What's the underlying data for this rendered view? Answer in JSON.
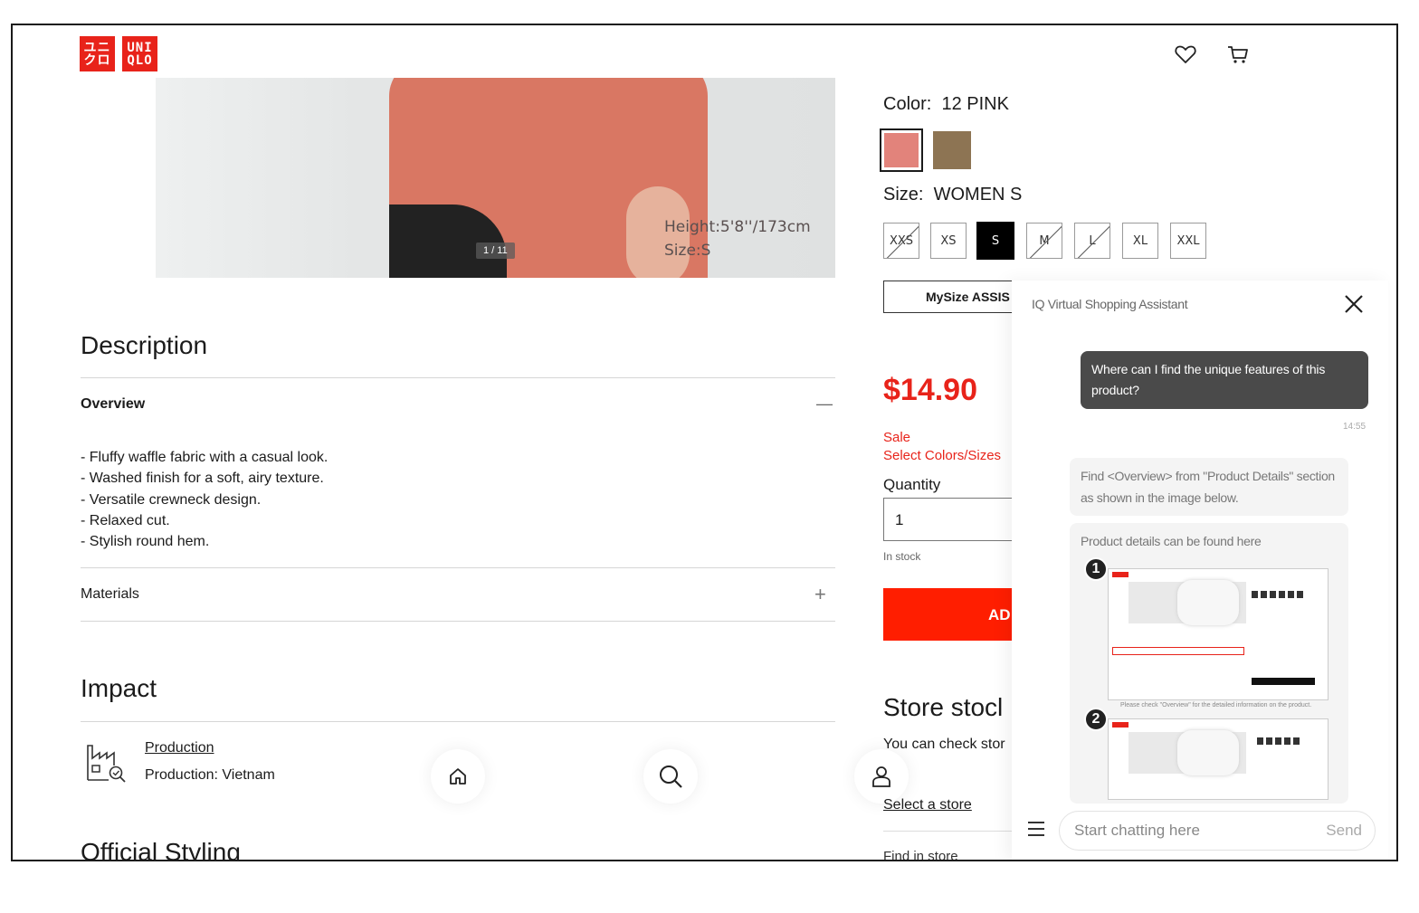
{
  "brand": {
    "logo_left": [
      "ユニ",
      "クロ"
    ],
    "logo_right": [
      "UNI",
      "QLO"
    ]
  },
  "hero": {
    "caption_height": "Height:5'8''/173cm",
    "caption_size": "Size:S",
    "counter": "1 / 11"
  },
  "description": {
    "title": "Description",
    "overview_label": "Overview",
    "collapse_glyph": "—",
    "bullets": [
      "- Fluffy waffle fabric with a casual look.",
      "- Washed finish for a soft, airy texture.",
      "- Versatile crewneck design.",
      "- Relaxed cut.",
      "- Stylish round hem."
    ],
    "materials_label": "Materials",
    "expand_glyph": "+"
  },
  "impact": {
    "title": "Impact",
    "production_link": "Production",
    "production_text": "Production: Vietnam"
  },
  "official_styling": "Official Styling",
  "product": {
    "color_label": "Color:",
    "color_value": "12 PINK",
    "swatches": [
      {
        "name": "12 PINK",
        "hex": "#e2837b",
        "selected": true
      },
      {
        "name": "brown",
        "hex": "#8d7453",
        "selected": false
      }
    ],
    "size_label": "Size:",
    "size_value": "WOMEN S",
    "sizes": [
      {
        "label": "XXS",
        "state": "unavailable"
      },
      {
        "label": "XS",
        "state": "available"
      },
      {
        "label": "S",
        "state": "selected"
      },
      {
        "label": "M",
        "state": "unavailable"
      },
      {
        "label": "L",
        "state": "unavailable"
      },
      {
        "label": "XL",
        "state": "available"
      },
      {
        "label": "XXL",
        "state": "available"
      }
    ],
    "mysize_label": "MySize ASSIS",
    "price": "$14.90",
    "sale_label": "Sale",
    "select_hint": "Select Colors/Sizes",
    "quantity_label": "Quantity",
    "quantity_value": "1",
    "stock_status": "In stock",
    "add_button": "AD",
    "store_title": "Store stocl",
    "store_check": "You can check stor",
    "select_store": "Select a store",
    "find_in_store": "Find in store"
  },
  "chat": {
    "title": "IQ Virtual Shopping Assistant",
    "user_message": "Where can I find the unique features of this product?",
    "timestamp": "14:55",
    "bot_message": "Find <Overview> from \"Product Details\" section as shown in the image below.",
    "card_text": "Product details can be found here",
    "step1": "1",
    "step2": "2",
    "thumb_caption": "Please check \"Overview\" for the detailed information on the product.",
    "input_placeholder": "Start chatting here",
    "send_label": "Send"
  },
  "colors": {
    "brand_red": "#e8231a",
    "add_button_red": "#ff1e00",
    "user_bubble": "#4a4a4a"
  },
  "icons": [
    "heart-icon",
    "cart-icon",
    "home-icon",
    "search-icon",
    "user-icon",
    "factory-icon",
    "close-icon",
    "menu-icon"
  ]
}
